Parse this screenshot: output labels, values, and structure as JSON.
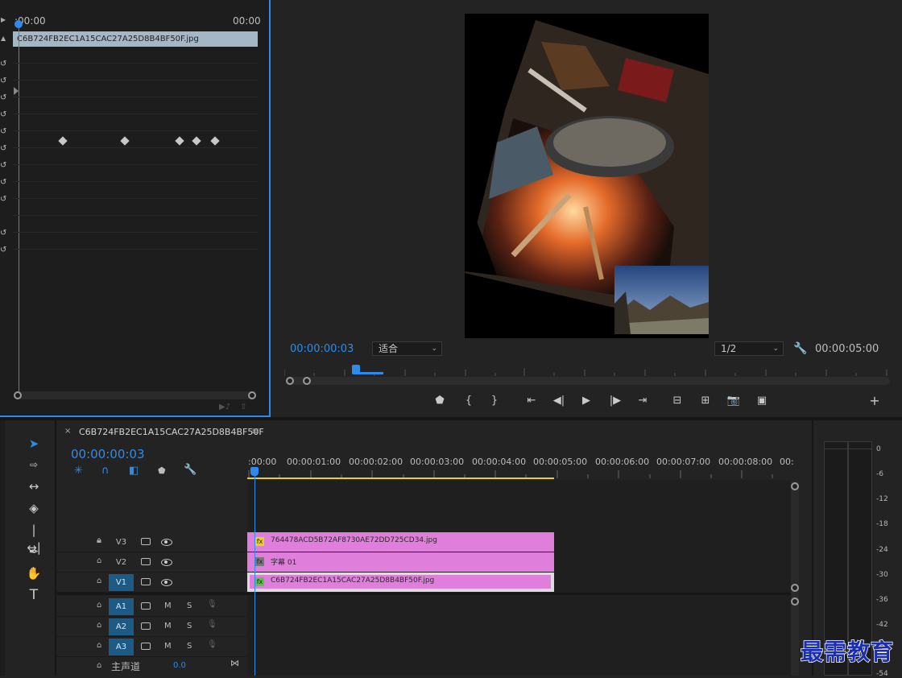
{
  "effect_controls": {
    "time_start": ":00:00",
    "time_end": "00:00",
    "clip_name": "C6B724FB2EC1A15CAC27A25D8B4BF50F.jpg"
  },
  "program_monitor": {
    "current_time": "00:00:00:03",
    "fit_label": "适合",
    "resolution_label": "1/2",
    "duration": "00:00:05:00"
  },
  "sequence": {
    "name": "C6B724FB2EC1A15CAC27A25D8B4BF50F",
    "timecode": "00:00:00:03",
    "ruler": [
      ":00:00",
      "00:00:01:00",
      "00:00:02:00",
      "00:00:03:00",
      "00:00:04:00",
      "00:00:05:00",
      "00:00:06:00",
      "00:00:07:00",
      "00:00:08:00",
      "00:"
    ]
  },
  "tracks": {
    "video": [
      {
        "label": "V3",
        "clip": "764478ACD5B72AF8730AE72DD725CD34.jpg",
        "selected": false
      },
      {
        "label": "V2",
        "clip": "字幕 01",
        "selected": false
      },
      {
        "label": "V1",
        "clip": "C6B724FB2EC1A15CAC27A25D8B4BF50F.jpg",
        "selected": true
      }
    ],
    "audio": [
      {
        "label": "A1",
        "m": "M",
        "s": "S"
      },
      {
        "label": "A2",
        "m": "M",
        "s": "S"
      },
      {
        "label": "A3",
        "m": "M",
        "s": "S"
      }
    ],
    "master_label": "主声道",
    "master_value": "0.0"
  },
  "meter": {
    "db_labels": [
      "0",
      "-6",
      "-12",
      "-18",
      "-24",
      "-30",
      "-36",
      "-42",
      "-48",
      "-54"
    ]
  },
  "watermark": "最需教育",
  "colors": {
    "accent_blue": "#2d8ceb",
    "clip_pink": "#e07fdb",
    "track_blue": "#1e5a86",
    "work_area_yellow": "#e6d21a"
  }
}
